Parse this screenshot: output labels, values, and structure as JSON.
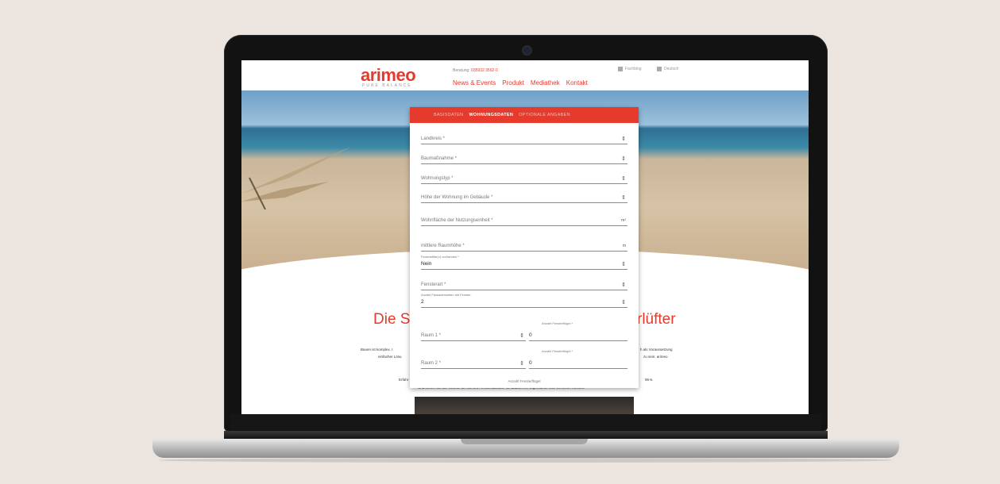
{
  "header": {
    "logo": "arimeo",
    "logo_sub": "PURE BALANCE",
    "beratung_label": "Beratung:",
    "beratung_phone": "035932 3592-0",
    "nav": [
      "News & Events",
      "Produkt",
      "Mediathek",
      "Kontakt"
    ],
    "util_fachblog": "Fachblog",
    "util_lang": "Deutsch"
  },
  "modal": {
    "tabs": [
      "BASISDATEN",
      "WOHNUNGSDATEN",
      "OPTIONALE ANGABEN"
    ],
    "active_tab": "WOHNUNGSDATEN",
    "fields": {
      "landkreis": "Landkreis *",
      "baumassnahme": "Baumaßnahme *",
      "wohnungstyp": "Wohnungstyp *",
      "hoehe": "Höhe der Wohnung im Gebäude *",
      "wohnflaeche": "Wohnfläche der Nutzungseinheit *",
      "wohnflaeche_unit": "m²",
      "raumhoehe": "mittlere Raumhöhe *",
      "raumhoehe_unit": "m",
      "feuerstaette_label": "Feuerstätte(n) vorhanden *",
      "feuerstaette_value": "Nein",
      "fensterart": "Fensterart *",
      "fassaden_label": "Anzahl Fassadenseiten mit Fenster",
      "fassaden_value": "2",
      "raum1": "Raum 1 *",
      "raum1_fluegel_label": "Anzahl Fensterflügel *",
      "raum1_fluegel_value": "0",
      "raum2": "Raum 2 *",
      "raum2_fluegel_label": "Anzahl Fensterflügel *",
      "raum2_fluegel_value": "0",
      "footer_label": "Anzahl Fensterflügel"
    }
  },
  "page": {
    "title_left": "Die Si",
    "title_right": "rlüfter",
    "para1_left": "Bauen ist komplex. I",
    "para1_right": "h als Voraussetzung",
    "para2_left": "einfacher Lösu",
    "para2_right": "zu sein. arimeo",
    "para3_left": "Erfahr",
    "para3_right": "96-6.",
    "para4": "Und lernen Sie die Vorteile der arimeo Fensterfalzlüfter für Bauherren, Eigentümer und Vermieter kennen."
  },
  "colors": {
    "brand": "#e63a2c"
  }
}
